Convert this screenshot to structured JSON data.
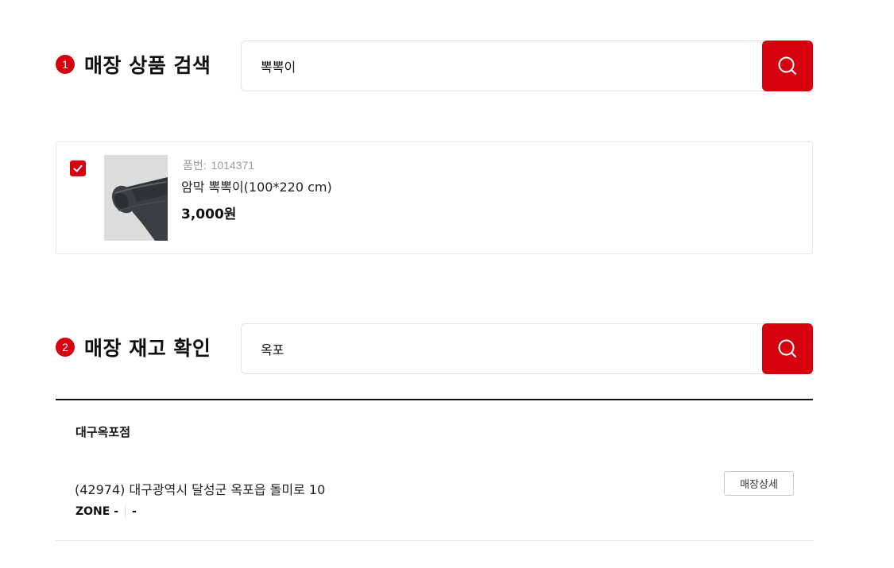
{
  "sections": {
    "product_search": {
      "step": "1",
      "title": "매장 상품 검색",
      "query": "뽁뽁이"
    },
    "stock_check": {
      "step": "2",
      "title": "매장 재고 확인",
      "query": "옥포"
    }
  },
  "product": {
    "code_label": "품번:",
    "code": "1014371",
    "name": "암막 뽁뽁이(100*220 cm)",
    "price": "3,000원",
    "checked": true
  },
  "store": {
    "name": "대구옥포점",
    "address": "(42974) 대구광역시 달성군 옥포읍 돌미로 10",
    "zone_label": "ZONE -",
    "zone_value": "-",
    "detail_button": "매장상세"
  },
  "icons": {
    "search": "search-icon",
    "check": "check-icon"
  },
  "colors": {
    "accent": "#d7000f"
  }
}
